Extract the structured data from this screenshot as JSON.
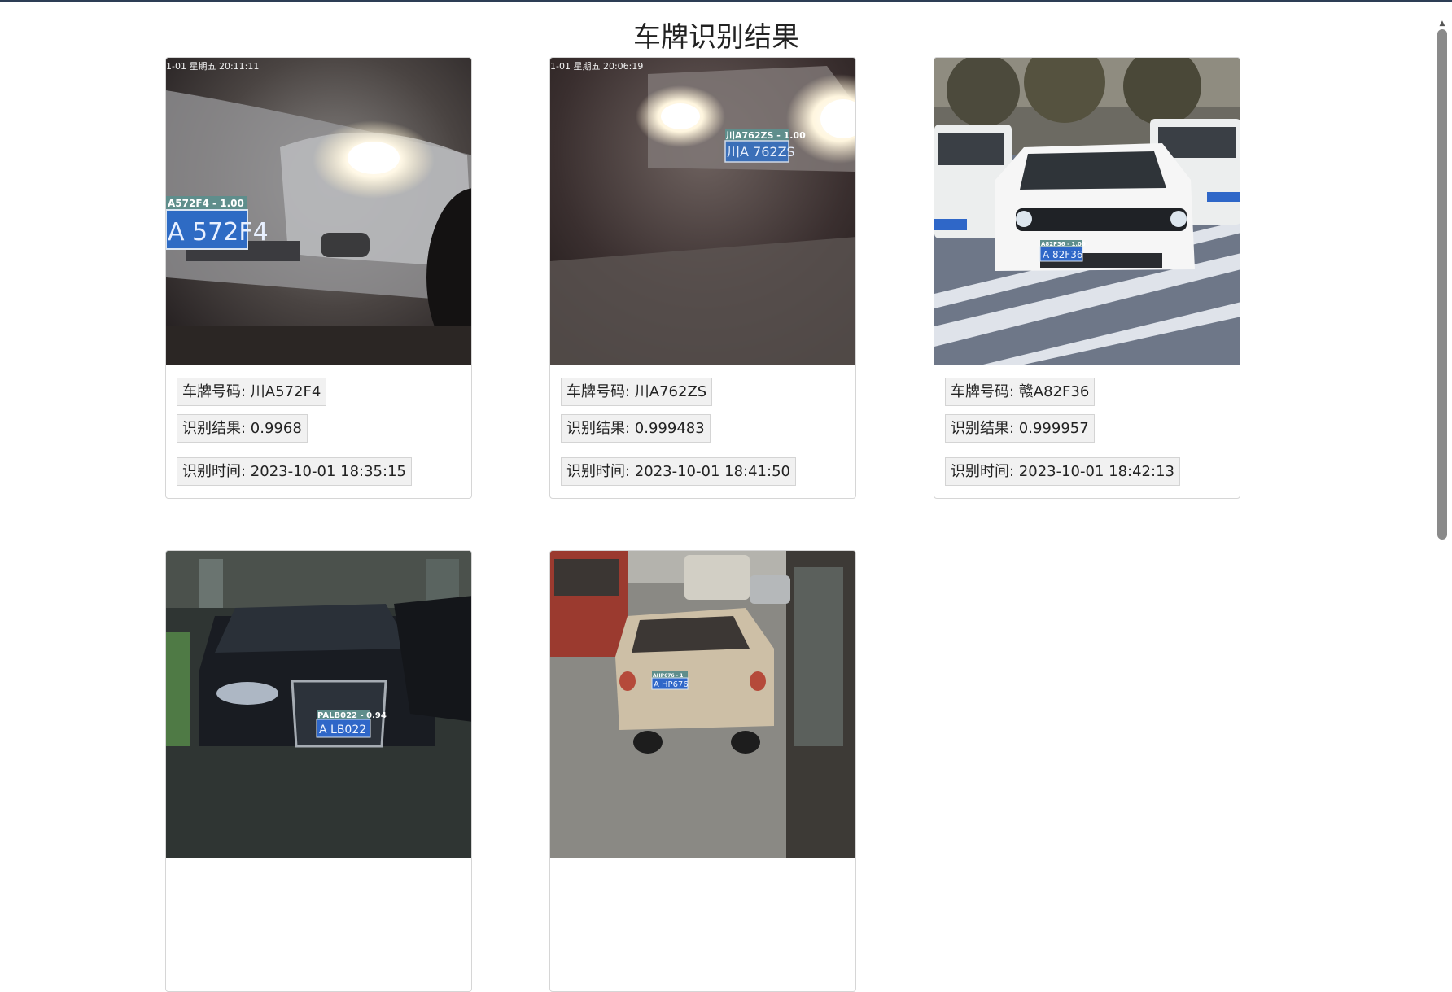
{
  "page": {
    "title": "车牌识别结果"
  },
  "labels": {
    "plate": "车牌号码: ",
    "score": "识别结果: ",
    "time": "识别时间: "
  },
  "cards": [
    {
      "plate": "川A572F4",
      "score": "0.9968",
      "time": "2023-10-01 18:35:15",
      "overlay_timestamp": "1-01 星期五 20:11:11",
      "detection_label": "A572F4 - 1.00",
      "plate_in_image": "A 572F4"
    },
    {
      "plate": "川A762ZS",
      "score": "0.999483",
      "time": "2023-10-01 18:41:50",
      "overlay_timestamp": "1-01 星期五 20:06:19",
      "detection_label": "川A762ZS - 1.00",
      "plate_in_image": "川A 762ZS"
    },
    {
      "plate": "赣A82F36",
      "score": "0.999957",
      "time": "2023-10-01 18:42:13",
      "detection_label": "A82F36 - 1.00",
      "plate_in_image": "A 82F36"
    },
    {
      "detection_label": "PALB022 - 0.94",
      "plate_in_image": "A LB022"
    },
    {
      "detection_label": "AHP676 - 1",
      "plate_in_image": "A HP676"
    }
  ],
  "colors": {
    "plate_blue": "#2c63c7",
    "label_bg": "#5a8a8a",
    "border": "#d6d6d6"
  }
}
